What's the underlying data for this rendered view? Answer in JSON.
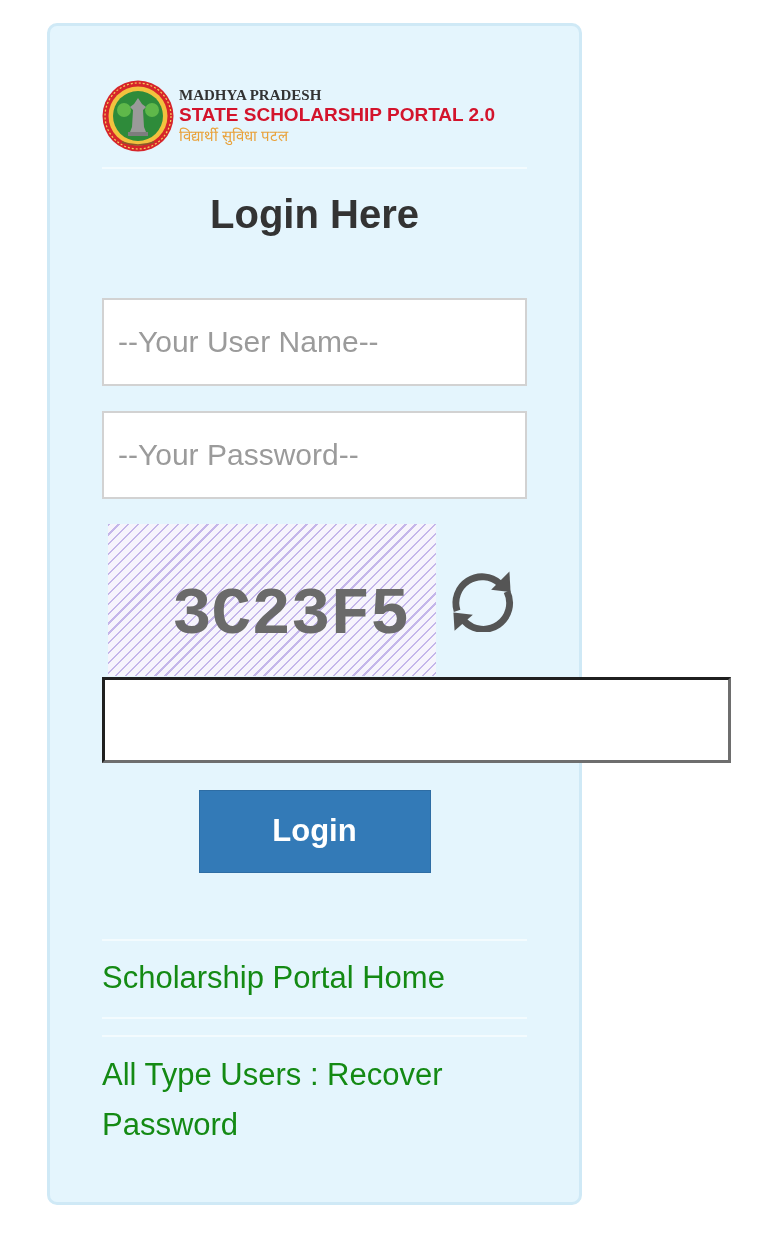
{
  "logo": {
    "state": "MADHYA PRADESH",
    "title": "STATE SCHOLARSHIP PORTAL 2.0",
    "tagline": "विद्यार्थी सुविधा पटल"
  },
  "heading": "Login Here",
  "username": {
    "placeholder": "--Your User Name--"
  },
  "password": {
    "placeholder": "--Your Password--"
  },
  "captcha": {
    "text": "3C23F5"
  },
  "login_button": "Login",
  "links": [
    "Scholarship Portal Home",
    "All Type Users : Recover Password"
  ]
}
